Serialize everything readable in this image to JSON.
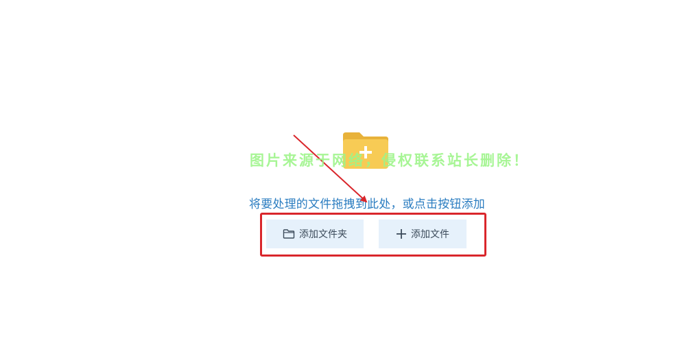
{
  "dropzone": {
    "instruction": "将要处理的文件拖拽到此处，或点击按钮添加",
    "add_folder_label": "添加文件夹",
    "add_file_label": "添加文件"
  },
  "overlay": {
    "watermark": "图片来源于网络，侵权联系站长删除！"
  },
  "colors": {
    "folder": "#f5c54c",
    "accent_text": "#2a7cc0",
    "button_bg": "#e6f1fb",
    "highlight": "#d9262b",
    "watermark": "#9ef58a"
  }
}
